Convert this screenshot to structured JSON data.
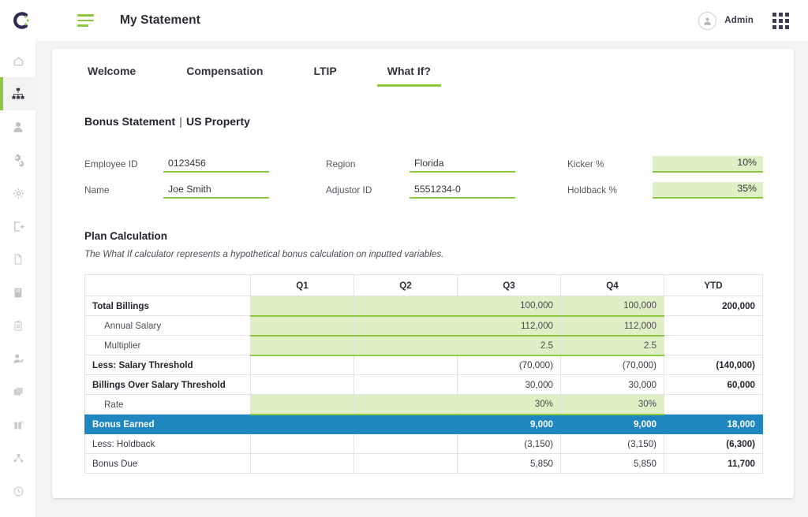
{
  "header": {
    "logo": "brand-logo-c",
    "menu_icon": "hamburger-menu-icon",
    "title": "My Statement",
    "user_label": "Admin",
    "avatar_icon": "user-avatar-icon",
    "apps_icon": "apps-grid-icon"
  },
  "sidebar": {
    "items": [
      {
        "icon": "home-icon",
        "active": false
      },
      {
        "icon": "org-chart-icon",
        "active": true
      },
      {
        "icon": "person-icon",
        "active": false
      },
      {
        "icon": "gears-icon",
        "active": false
      },
      {
        "icon": "settings-gear-icon",
        "active": false
      },
      {
        "icon": "export-icon",
        "active": false
      },
      {
        "icon": "document-icon",
        "active": false
      },
      {
        "icon": "book-icon",
        "active": false
      },
      {
        "icon": "clipboard-icon",
        "active": false
      },
      {
        "icon": "user-edit-icon",
        "active": false
      },
      {
        "icon": "layers-icon",
        "active": false
      },
      {
        "icon": "gift-icon",
        "active": false
      },
      {
        "icon": "share-network-icon",
        "active": false
      },
      {
        "icon": "clock-history-icon",
        "active": false
      }
    ]
  },
  "tabs": [
    {
      "label": "Welcome",
      "active": false
    },
    {
      "label": "Compensation",
      "active": false
    },
    {
      "label": "LTIP",
      "active": false
    },
    {
      "label": "What If?",
      "active": true
    }
  ],
  "statement": {
    "title": "Bonus Statement",
    "divider": "|",
    "subtitle": "US Property"
  },
  "form": {
    "employee_id": {
      "label": "Employee ID",
      "value": "0123456"
    },
    "name": {
      "label": "Name",
      "value": "Joe Smith"
    },
    "region": {
      "label": "Region",
      "value": "Florida"
    },
    "adjustor_id": {
      "label": "Adjustor ID",
      "value": "5551234-0"
    },
    "kicker_pct": {
      "label": "Kicker %",
      "value": "10%"
    },
    "holdback_pct": {
      "label": "Holdback %",
      "value": "35%"
    }
  },
  "plan": {
    "title": "Plan Calculation",
    "note": "The What If calculator represents a hypothetical bonus calculation on inputted variables."
  },
  "table": {
    "columns": [
      "",
      "Q1",
      "Q2",
      "Q3",
      "Q4",
      "YTD"
    ],
    "rows": [
      {
        "label": "Total Billings",
        "style": "bold",
        "editable": true,
        "q1": "",
        "q2": "",
        "q3": "100,000",
        "q4": "100,000",
        "ytd": "200,000"
      },
      {
        "label": "Annual Salary",
        "style": "indent",
        "editable": true,
        "q1": "",
        "q2": "",
        "q3": "112,000",
        "q4": "112,000",
        "ytd": ""
      },
      {
        "label": "Multiplier",
        "style": "indent",
        "editable": true,
        "q1": "",
        "q2": "",
        "q3": "2.5",
        "q4": "2.5",
        "ytd": ""
      },
      {
        "label": "Less: Salary Threshold",
        "style": "bold",
        "editable": false,
        "q1": "",
        "q2": "",
        "q3": "(70,000)",
        "q4": "(70,000)",
        "ytd": "(140,000)"
      },
      {
        "label": "Billings Over Salary Threshold",
        "style": "bold",
        "editable": false,
        "q1": "",
        "q2": "",
        "q3": "30,000",
        "q4": "30,000",
        "ytd": "60,000"
      },
      {
        "label": "Rate",
        "style": "indent",
        "editable": true,
        "q1": "",
        "q2": "",
        "q3": "30%",
        "q4": "30%",
        "ytd": ""
      },
      {
        "label": "Bonus Earned",
        "style": "highlight",
        "editable": false,
        "q1": "",
        "q2": "",
        "q3": "9,000",
        "q4": "9,000",
        "ytd": "18,000"
      },
      {
        "label": "Less: Holdback",
        "style": "plain",
        "editable": false,
        "q1": "",
        "q2": "",
        "q3": "(3,150)",
        "q4": "(3,150)",
        "ytd": "(6,300)"
      },
      {
        "label": "Bonus Due",
        "style": "plain",
        "editable": false,
        "q1": "",
        "q2": "",
        "q3": "5,850",
        "q4": "5,850",
        "ytd": "11,700"
      }
    ]
  },
  "colors": {
    "accent_green": "#8dc63f",
    "green_fill": "#dff0c6",
    "highlight_blue": "#1e87c0",
    "logo_navy": "#2b2b55",
    "page_bg": "#f4f4f4"
  }
}
